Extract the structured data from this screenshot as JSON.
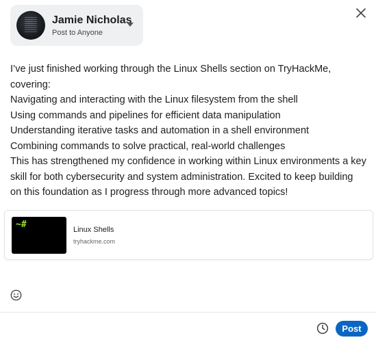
{
  "author": {
    "name": "Jamie Nicholas",
    "audience": "Post to Anyone"
  },
  "post": {
    "lines": [
      "I’ve just finished working through the Linux Shells section on TryHackMe, covering:",
      "Navigating and interacting with the Linux filesystem from the shell",
      "Using commands and pipelines for efficient data manipulation",
      "Understanding iterative tasks and automation in a shell environment",
      "Combining commands to solve practical, real-world challenges",
      "This has strengthened my confidence in working within Linux environments a key skill for both cybersecurity and system administration. Excited to keep building on this foundation as I progress through more advanced topics!"
    ]
  },
  "link_preview": {
    "thumb_text": "~#",
    "title": "Linux Shells",
    "domain": "tryhackme.com"
  },
  "footer": {
    "post_label": "Post"
  },
  "colors": {
    "accent": "#0a66c2",
    "prompt_green": "#9be22d"
  },
  "icons": [
    "close-icon",
    "caret-down-icon",
    "emoji-icon",
    "clock-icon"
  ]
}
